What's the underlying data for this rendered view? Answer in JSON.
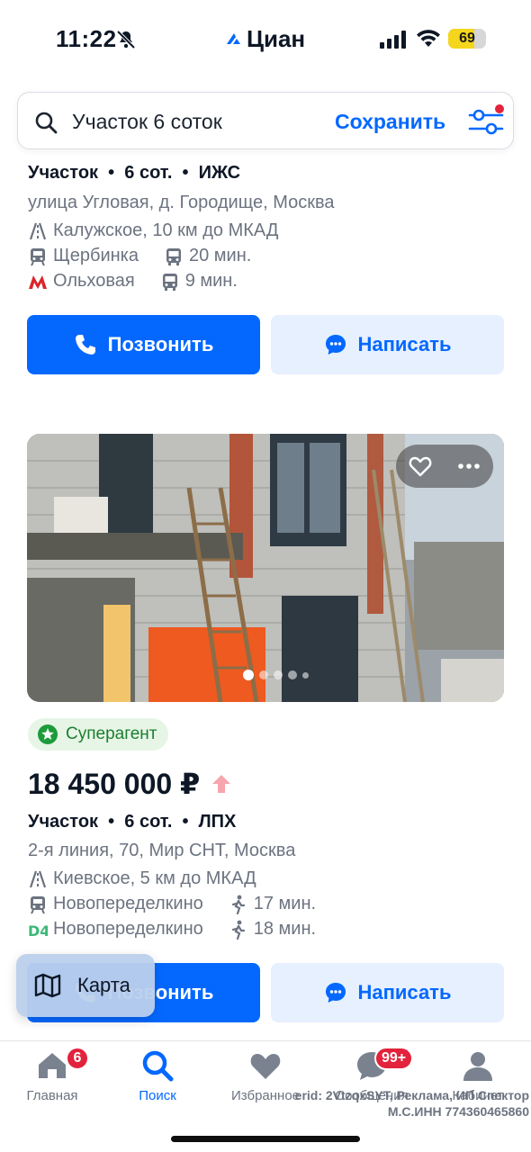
{
  "status_bar": {
    "time": "11:22",
    "carrier": "Циан",
    "battery": "69",
    "battery_level": 0.69
  },
  "search": {
    "query": "Участок 6 соток",
    "save_label": "Сохранить"
  },
  "listing1": {
    "summary": "Участок  •  6 сот.  •  ИЖС",
    "address": "улица Угловая, д. Городище, Москва",
    "highway": "Калужское, 10 км до МКАД",
    "station1": "Щербинка",
    "station1_time": "20 мин.",
    "station2": "Ольховая",
    "station2_time": "9 мин.",
    "call_label": "Позвонить",
    "write_label": "Написать"
  },
  "listing2": {
    "badge": "Суперагент",
    "price": "18 450 000 ₽",
    "summary": "Участок  •  6 сот.  •  ЛПХ",
    "address": "2-я линия, 70, Мир СНТ, Москва",
    "highway": "Киевское, 5 км до МКАД",
    "station1": "Новопеределкино",
    "station1_time": "17 мин.",
    "station2": "Новопеределкино",
    "station2_time": "18 мин.",
    "call_label": "Позвонить",
    "write_label": "Написать"
  },
  "map_button": {
    "label": "Карта"
  },
  "tabs": [
    {
      "label": "Главная",
      "badge": "6",
      "icon": "home-icon"
    },
    {
      "label": "Поиск",
      "icon": "search-icon"
    },
    {
      "label": "Избранное",
      "icon": "heart-icon"
    },
    {
      "label": "Сообщения",
      "badge": "99+",
      "icon": "chat-icon"
    },
    {
      "label": "Кабинет",
      "icon": "profile-icon"
    }
  ],
  "ad_note": "erid: 2VtzqxSYT, Реклама, ИП Спектор М.С.ИНН 774360465860",
  "colors": {
    "accent": "#0468ff",
    "accent_light": "#e6f0ff",
    "badge_green": "#1c7f2f",
    "badge_red": "#e3223c",
    "metro_red": "#d9262c",
    "d4_green": "#3cb878"
  }
}
